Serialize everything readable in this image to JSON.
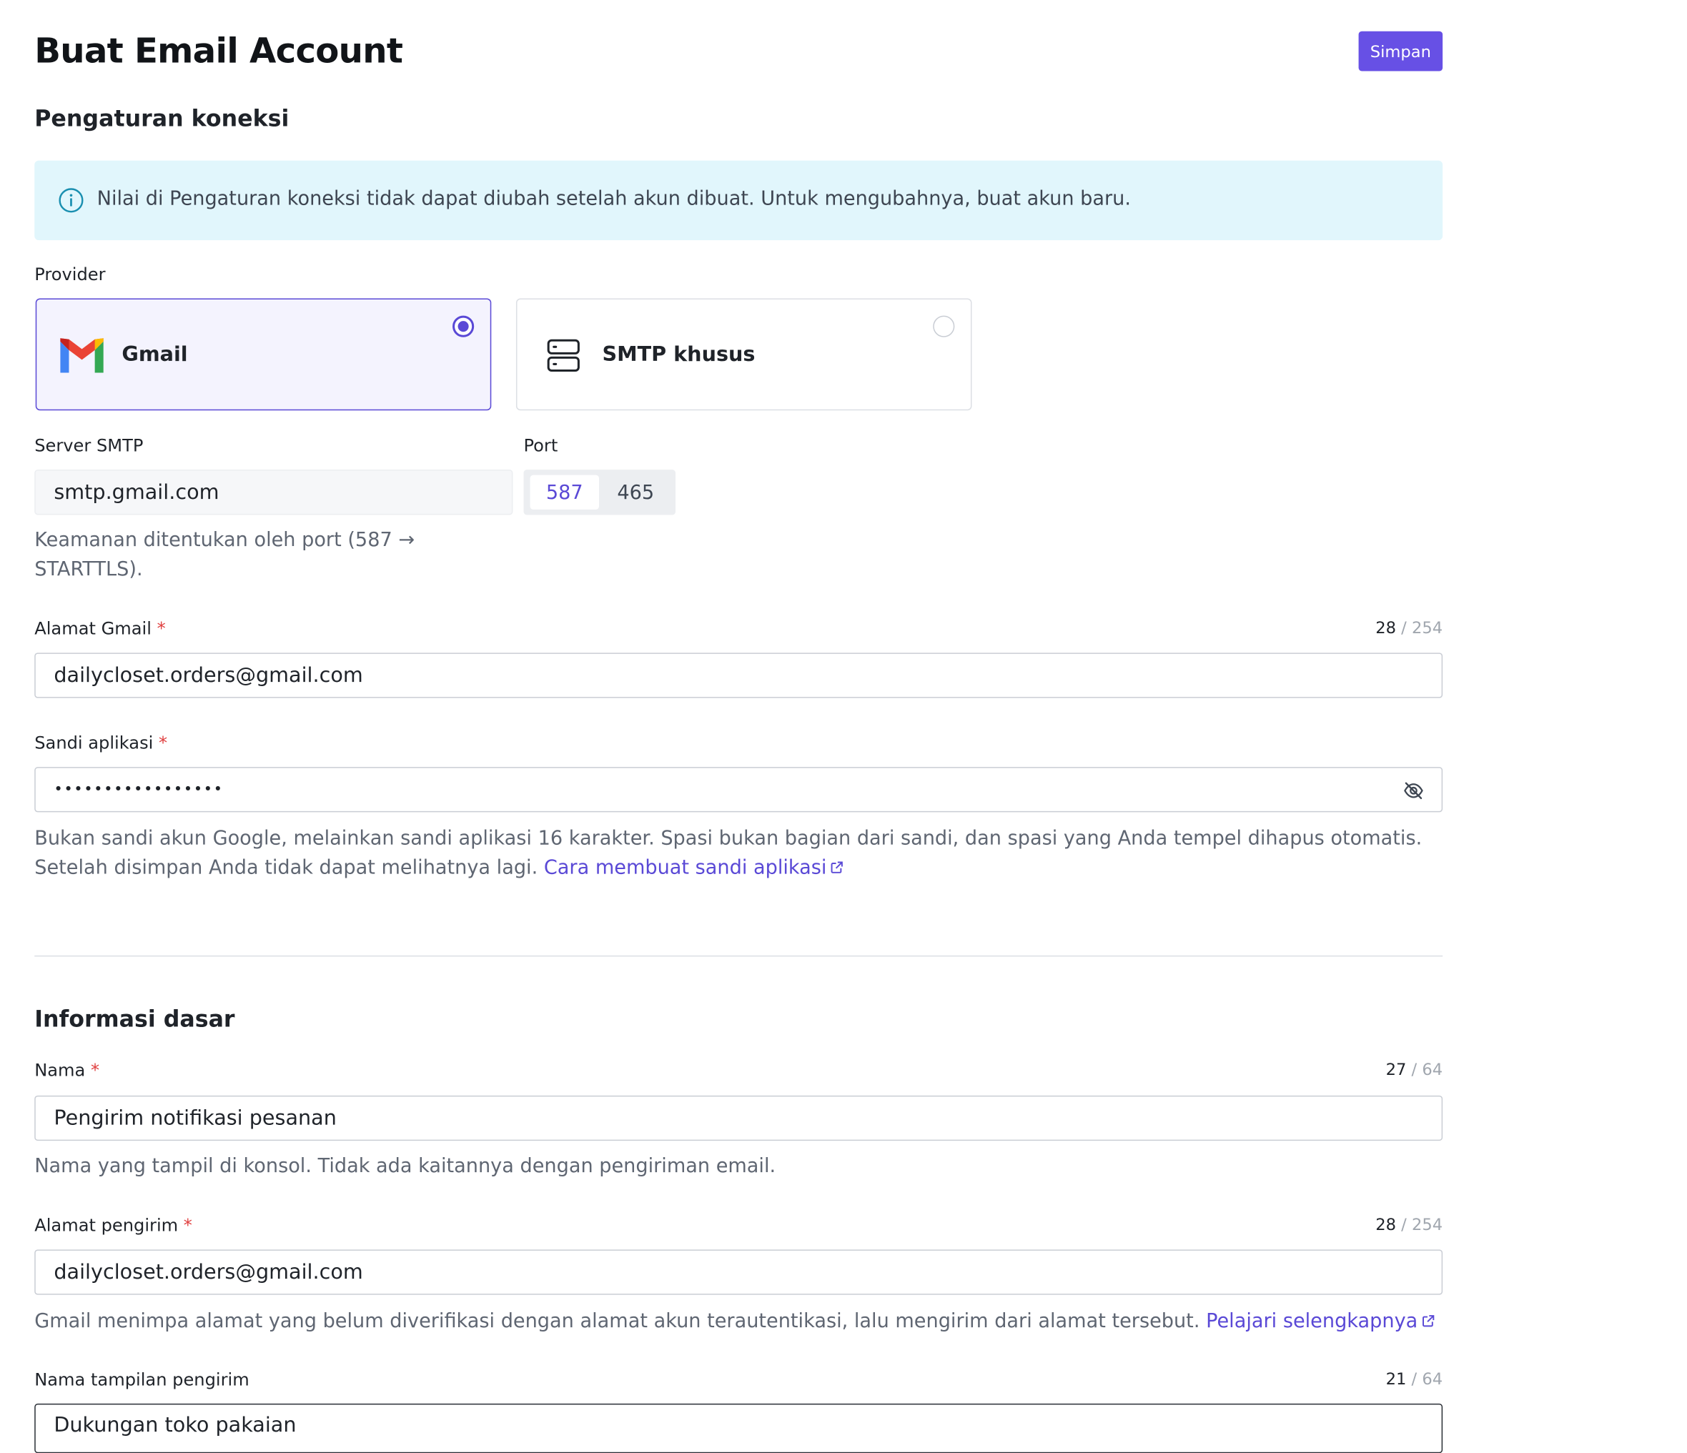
{
  "page": {
    "title": "Buat Email Account",
    "save_label": "Simpan"
  },
  "connection": {
    "section_title": "Pengaturan koneksi",
    "info_text": "Nilai di Pengaturan koneksi tidak dapat diubah setelah akun dibuat. Untuk mengubahnya, buat akun baru.",
    "provider_label": "Provider",
    "providers": [
      {
        "label": "Gmail",
        "icon": "gmail-icon",
        "selected": true
      },
      {
        "label": "SMTP khusus",
        "icon": "server-icon",
        "selected": false
      }
    ],
    "smtp_label": "Server SMTP",
    "smtp_value": "smtp.gmail.com",
    "port_label": "Port",
    "ports": [
      "587",
      "465"
    ],
    "selected_port": "587",
    "security_help_line1": "Keamanan ditentukan oleh port (587 →",
    "security_help_line2": "STARTTLS).",
    "gmail_address_label": "Alamat Gmail",
    "gmail_address_count": "28",
    "gmail_address_max": "/ 254",
    "gmail_address_value": "dailycloset.orders@gmail.com",
    "app_password_label": "Sandi aplikasi",
    "app_password_value": "•••••••••••••••••",
    "app_password_help_line1": "Bukan sandi akun Google, melainkan sandi aplikasi 16 karakter. Spasi bukan bagian dari sandi, dan spasi yang Anda tempel dihapus otomatis.",
    "app_password_help_line2": "Setelah disimpan Anda tidak dapat melihatnya lagi.",
    "app_password_link": "Cara membuat sandi aplikasi"
  },
  "basic": {
    "section_title": "Informasi dasar",
    "name_label": "Nama",
    "name_count": "27",
    "name_max": "/ 64",
    "name_value": "Pengirim notifikasi pesanan",
    "name_help": "Nama yang tampil di konsol. Tidak ada kaitannya dengan pengiriman email.",
    "sender_label": "Alamat pengirim",
    "sender_count": "28",
    "sender_max": "/ 254",
    "sender_value": "dailycloset.orders@gmail.com",
    "sender_help": "Gmail menimpa alamat yang belum diverifikasi dengan alamat akun terautentikasi, lalu mengirim dari alamat tersebut.",
    "sender_link": "Pelajari selengkapnya",
    "display_name_label": "Nama tampilan pengirim",
    "display_name_count": "21",
    "display_name_max": "/ 64",
    "display_name_value": "Dukungan toko pakaian"
  },
  "colors": {
    "accent": "#6750e5",
    "selected_border": "#5a49d6",
    "info_bg": "#e1f6fc",
    "required": "#e04040"
  }
}
